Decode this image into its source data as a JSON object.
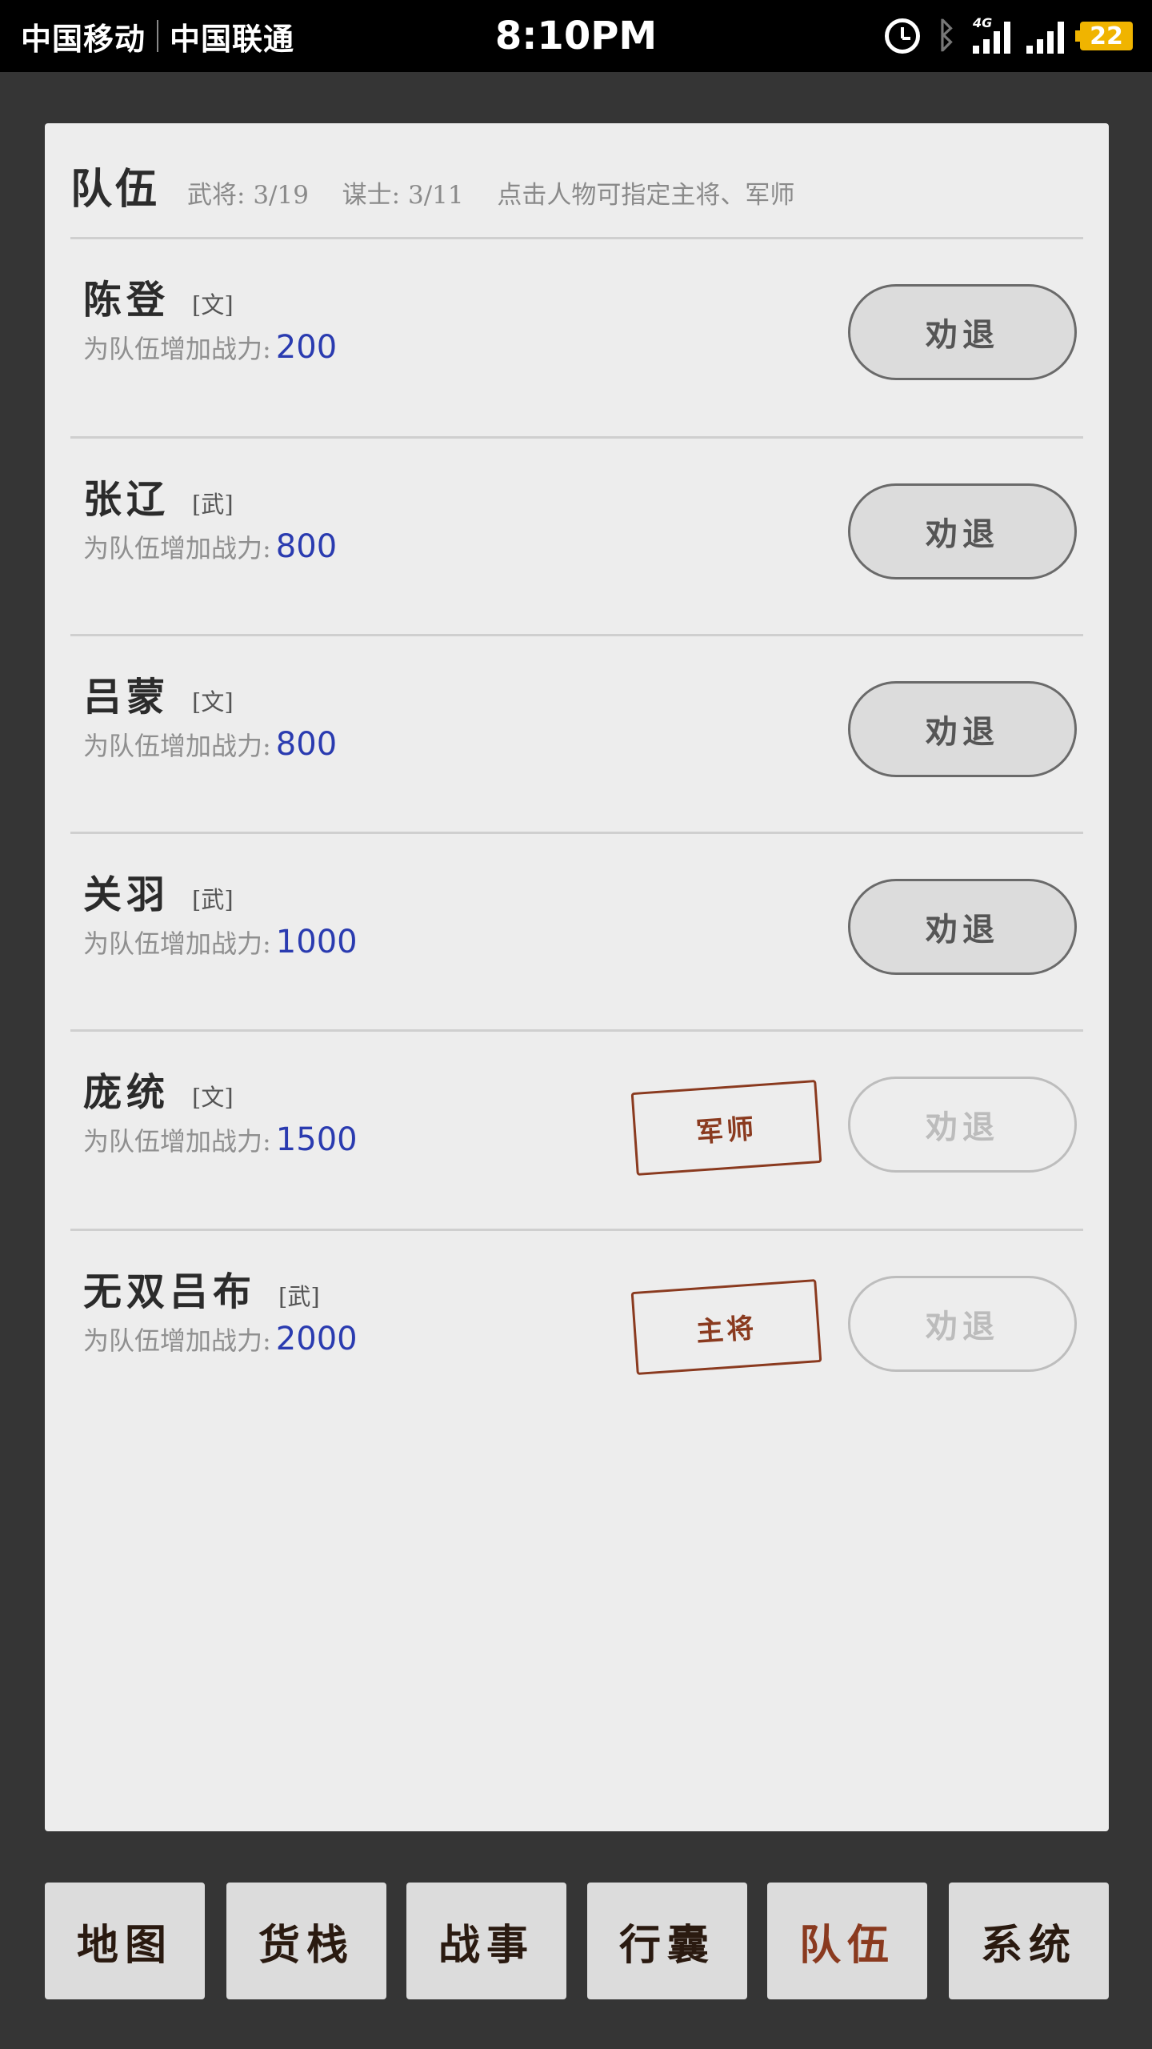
{
  "status_bar": {
    "carrier_1": "中国移动",
    "carrier_2": "中国联通",
    "time": "8:10PM",
    "network_label": "4G",
    "battery": "22",
    "battery_color": "#f0b400"
  },
  "team": {
    "title": "队伍",
    "generals_label": "武将:",
    "generals_count": "3/19",
    "advisors_label": "谋士:",
    "advisors_count": "3/11",
    "hint": "点击人物可指定主将、军师",
    "power_label": "为队伍增加战力:",
    "dismiss_label": "劝退",
    "members": [
      {
        "name": "陈登",
        "type": "[文]",
        "power": "200"
      },
      {
        "name": "张辽",
        "type": "[武]",
        "power": "800"
      },
      {
        "name": "吕蒙",
        "type": "[文]",
        "power": "800"
      },
      {
        "name": "关羽",
        "type": "[武]",
        "power": "1000"
      },
      {
        "name": "庞统",
        "type": "[文]",
        "power": "1500",
        "role": "军师"
      },
      {
        "name": "无双吕布",
        "type": "[武]",
        "power": "2000",
        "role": "主将"
      }
    ]
  },
  "nav": {
    "tabs": [
      "地图",
      "货栈",
      "战事",
      "行囊",
      "队伍",
      "系统"
    ],
    "active": "队伍",
    "active_color": "#8a3a1f"
  }
}
